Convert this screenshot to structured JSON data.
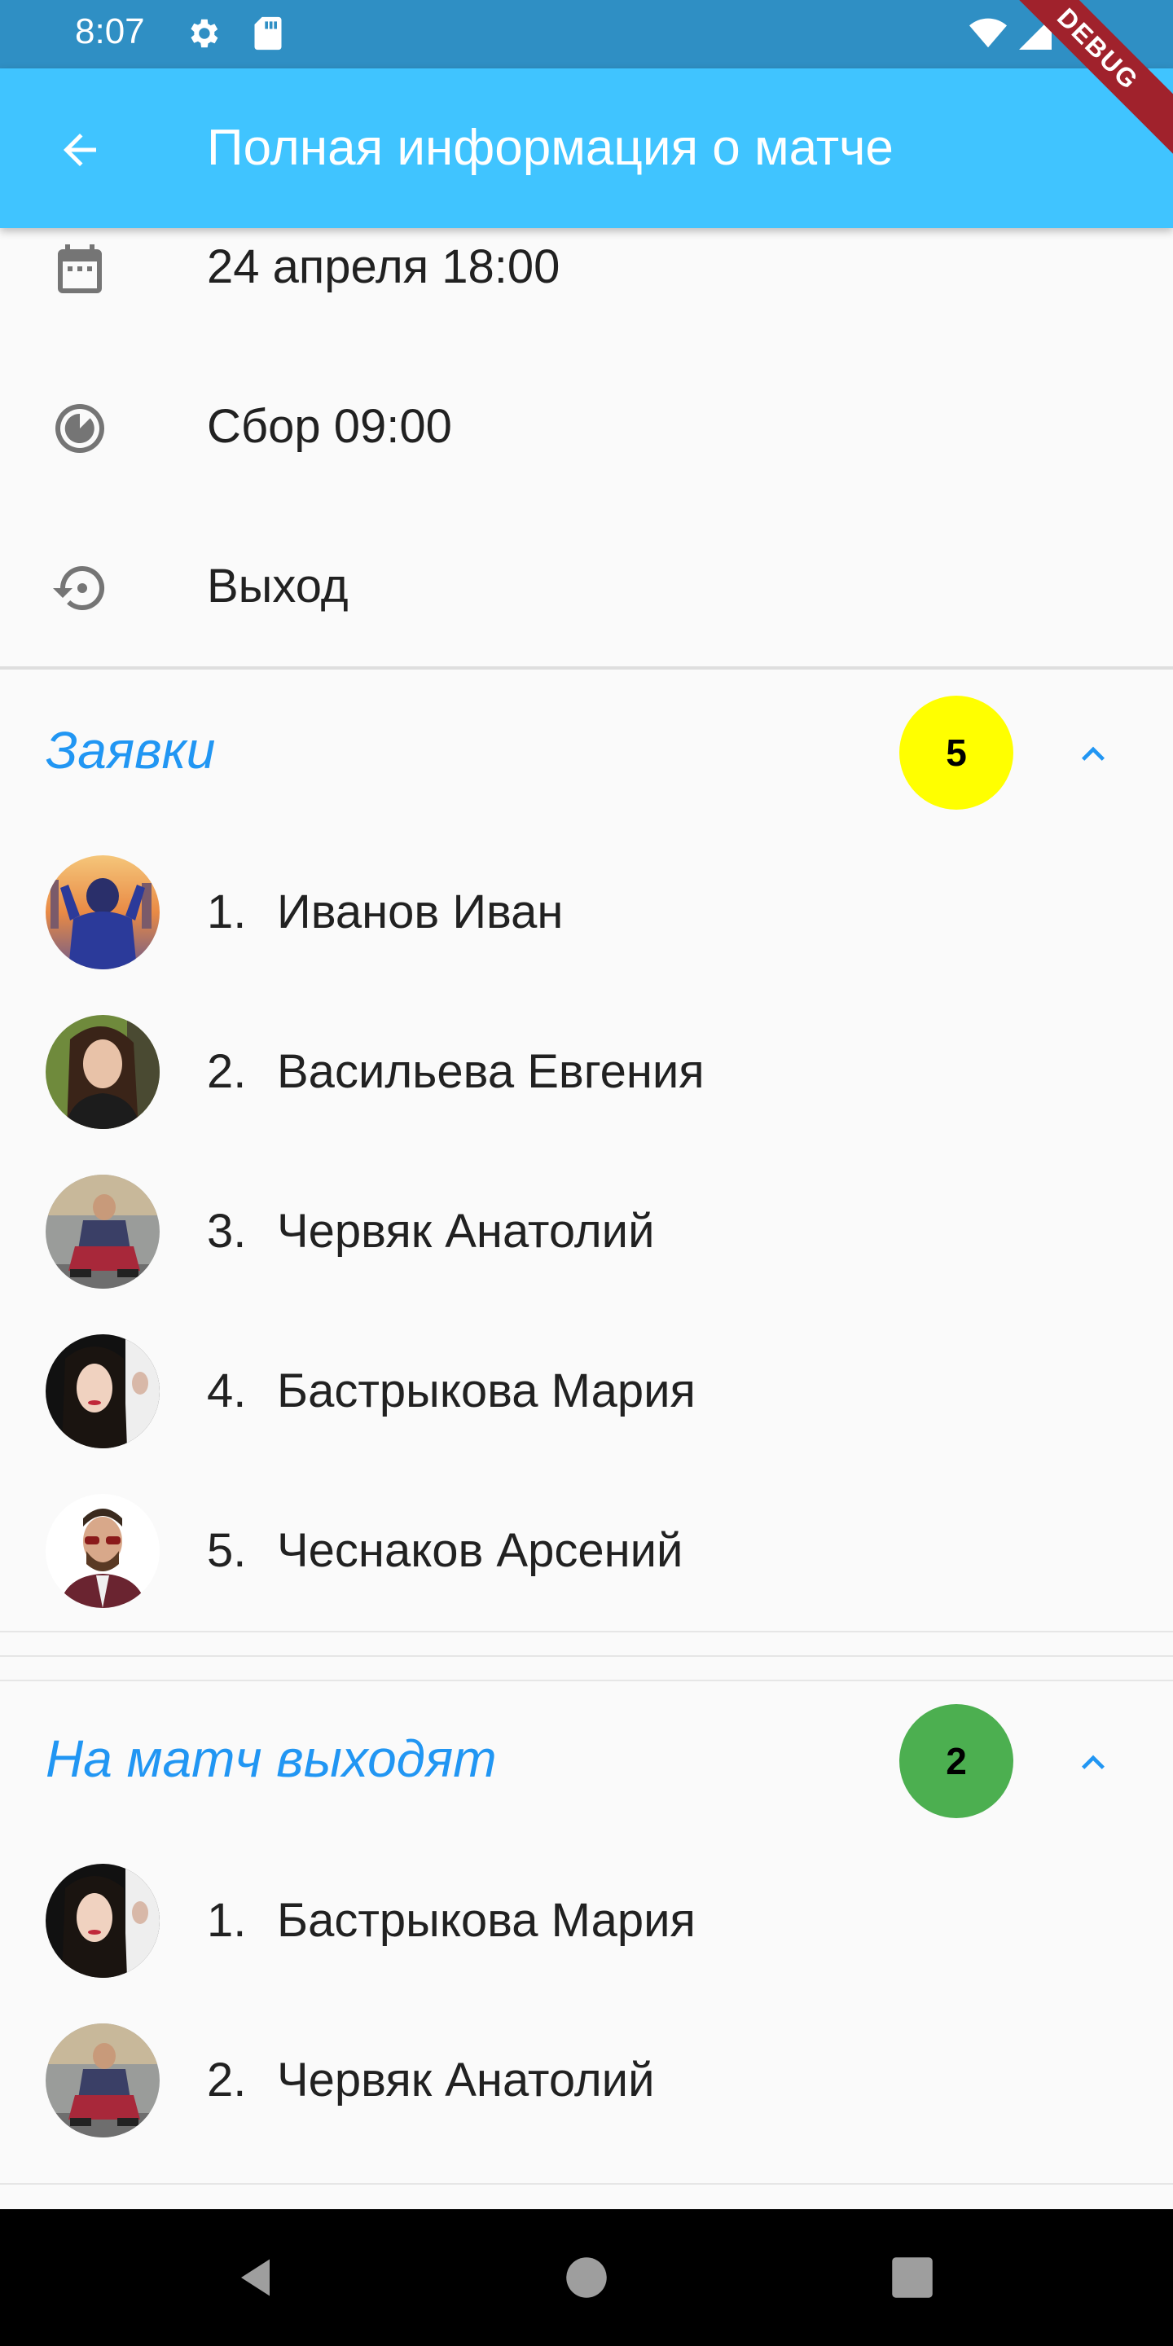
{
  "status_bar": {
    "time": "8:07",
    "icons": [
      "gear-icon",
      "sd-card-icon",
      "wifi-icon",
      "signal-icon",
      "battery-icon"
    ]
  },
  "debug_banner": "DEBUG",
  "app_bar": {
    "title": "Полная информация о матче",
    "back_icon": "arrow-back-icon",
    "background_color": "#40c4ff"
  },
  "info": {
    "date": "24 апреля 18:00",
    "gathering": "Сбор 09:00",
    "exit": "Выход"
  },
  "applications": {
    "title": "Заявки",
    "count": "5",
    "badge_color": "#ffff00",
    "players": [
      {
        "index": "1.",
        "name": "Иванов Иван"
      },
      {
        "index": "2.",
        "name": "Васильева Евгения"
      },
      {
        "index": "3.",
        "name": "Червяк Анатолий"
      },
      {
        "index": "4.",
        "name": "Бастрыкова Мария"
      },
      {
        "index": "5.",
        "name": "Чеснаков Арсений"
      }
    ]
  },
  "lineup": {
    "title": "На матч выходят",
    "count": "2",
    "badge_color": "#4caf50",
    "players": [
      {
        "index": "1.",
        "name": "Бастрыкова Мария"
      },
      {
        "index": "2.",
        "name": "Червяк Анатолий"
      }
    ]
  },
  "colors": {
    "accent": "#2196f3",
    "status_bar": "#2f8fc4"
  }
}
